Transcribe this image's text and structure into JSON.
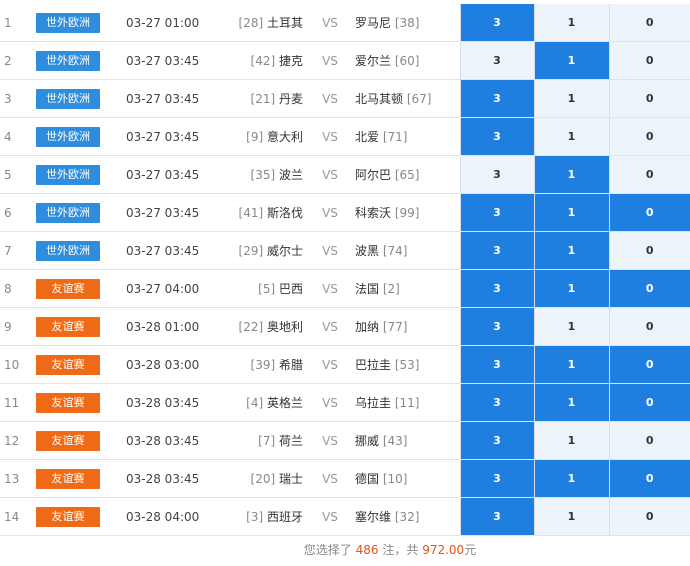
{
  "colors": {
    "selected": "#1f7fe0",
    "unselected": "#edf4fc",
    "badge_world": "#2f8ddd",
    "badge_friendly": "#ef6a16",
    "highlight": "#e0551c"
  },
  "rows": [
    {
      "num": "1",
      "league": "世外欧洲",
      "league_type": "world",
      "time": "03-27 01:00",
      "home_rank": "[28]",
      "home": "土耳其",
      "vs": "VS",
      "away": "罗马尼",
      "away_rank": "[38]",
      "opts": [
        {
          "label": "3",
          "selected": true
        },
        {
          "label": "1",
          "selected": false
        },
        {
          "label": "0",
          "selected": false
        }
      ]
    },
    {
      "num": "2",
      "league": "世外欧洲",
      "league_type": "world",
      "time": "03-27 03:45",
      "home_rank": "[42]",
      "home": "捷克",
      "vs": "VS",
      "away": "爱尔兰",
      "away_rank": "[60]",
      "opts": [
        {
          "label": "3",
          "selected": false
        },
        {
          "label": "1",
          "selected": true
        },
        {
          "label": "0",
          "selected": false
        }
      ]
    },
    {
      "num": "3",
      "league": "世外欧洲",
      "league_type": "world",
      "time": "03-27 03:45",
      "home_rank": "[21]",
      "home": "丹麦",
      "vs": "VS",
      "away": "北马其顿",
      "away_rank": "[67]",
      "opts": [
        {
          "label": "3",
          "selected": true
        },
        {
          "label": "1",
          "selected": false
        },
        {
          "label": "0",
          "selected": false
        }
      ]
    },
    {
      "num": "4",
      "league": "世外欧洲",
      "league_type": "world",
      "time": "03-27 03:45",
      "home_rank": "[9]",
      "home": "意大利",
      "vs": "VS",
      "away": "北爱",
      "away_rank": "[71]",
      "opts": [
        {
          "label": "3",
          "selected": true
        },
        {
          "label": "1",
          "selected": false
        },
        {
          "label": "0",
          "selected": false
        }
      ]
    },
    {
      "num": "5",
      "league": "世外欧洲",
      "league_type": "world",
      "time": "03-27 03:45",
      "home_rank": "[35]",
      "home": "波兰",
      "vs": "VS",
      "away": "阿尔巴",
      "away_rank": "[65]",
      "opts": [
        {
          "label": "3",
          "selected": false
        },
        {
          "label": "1",
          "selected": true
        },
        {
          "label": "0",
          "selected": false
        }
      ]
    },
    {
      "num": "6",
      "league": "世外欧洲",
      "league_type": "world",
      "time": "03-27 03:45",
      "home_rank": "[41]",
      "home": "斯洛伐",
      "vs": "VS",
      "away": "科索沃",
      "away_rank": "[99]",
      "opts": [
        {
          "label": "3",
          "selected": true
        },
        {
          "label": "1",
          "selected": true
        },
        {
          "label": "0",
          "selected": true
        }
      ]
    },
    {
      "num": "7",
      "league": "世外欧洲",
      "league_type": "world",
      "time": "03-27 03:45",
      "home_rank": "[29]",
      "home": "威尔士",
      "vs": "VS",
      "away": "波黑",
      "away_rank": "[74]",
      "opts": [
        {
          "label": "3",
          "selected": true
        },
        {
          "label": "1",
          "selected": true
        },
        {
          "label": "0",
          "selected": false
        }
      ]
    },
    {
      "num": "8",
      "league": "友谊赛",
      "league_type": "friendly",
      "time": "03-27 04:00",
      "home_rank": "[5]",
      "home": "巴西",
      "vs": "VS",
      "away": "法国",
      "away_rank": "[2]",
      "opts": [
        {
          "label": "3",
          "selected": true
        },
        {
          "label": "1",
          "selected": true
        },
        {
          "label": "0",
          "selected": true
        }
      ]
    },
    {
      "num": "9",
      "league": "友谊赛",
      "league_type": "friendly",
      "time": "03-28 01:00",
      "home_rank": "[22]",
      "home": "奥地利",
      "vs": "VS",
      "away": "加纳",
      "away_rank": "[77]",
      "opts": [
        {
          "label": "3",
          "selected": true
        },
        {
          "label": "1",
          "selected": false
        },
        {
          "label": "0",
          "selected": false
        }
      ]
    },
    {
      "num": "10",
      "league": "友谊赛",
      "league_type": "friendly",
      "time": "03-28 03:00",
      "home_rank": "[39]",
      "home": "希腊",
      "vs": "VS",
      "away": "巴拉圭",
      "away_rank": "[53]",
      "opts": [
        {
          "label": "3",
          "selected": true
        },
        {
          "label": "1",
          "selected": true
        },
        {
          "label": "0",
          "selected": true
        }
      ]
    },
    {
      "num": "11",
      "league": "友谊赛",
      "league_type": "friendly",
      "time": "03-28 03:45",
      "home_rank": "[4]",
      "home": "英格兰",
      "vs": "VS",
      "away": "乌拉圭",
      "away_rank": "[11]",
      "opts": [
        {
          "label": "3",
          "selected": true
        },
        {
          "label": "1",
          "selected": true
        },
        {
          "label": "0",
          "selected": true
        }
      ]
    },
    {
      "num": "12",
      "league": "友谊赛",
      "league_type": "friendly",
      "time": "03-28 03:45",
      "home_rank": "[7]",
      "home": "荷兰",
      "vs": "VS",
      "away": "挪威",
      "away_rank": "[43]",
      "opts": [
        {
          "label": "3",
          "selected": true
        },
        {
          "label": "1",
          "selected": false
        },
        {
          "label": "0",
          "selected": false
        }
      ]
    },
    {
      "num": "13",
      "league": "友谊赛",
      "league_type": "friendly",
      "time": "03-28 03:45",
      "home_rank": "[20]",
      "home": "瑞士",
      "vs": "VS",
      "away": "德国",
      "away_rank": "[10]",
      "opts": [
        {
          "label": "3",
          "selected": true
        },
        {
          "label": "1",
          "selected": true
        },
        {
          "label": "0",
          "selected": true
        }
      ]
    },
    {
      "num": "14",
      "league": "友谊赛",
      "league_type": "friendly",
      "time": "03-28 04:00",
      "home_rank": "[3]",
      "home": "西班牙",
      "vs": "VS",
      "away": "塞尔维",
      "away_rank": "[32]",
      "opts": [
        {
          "label": "3",
          "selected": true
        },
        {
          "label": "1",
          "selected": false
        },
        {
          "label": "0",
          "selected": false
        }
      ]
    }
  ],
  "summary": {
    "prefix": "您选择了",
    "count": "486",
    "mid": "注，共",
    "amount": "972.00",
    "unit": "元"
  }
}
